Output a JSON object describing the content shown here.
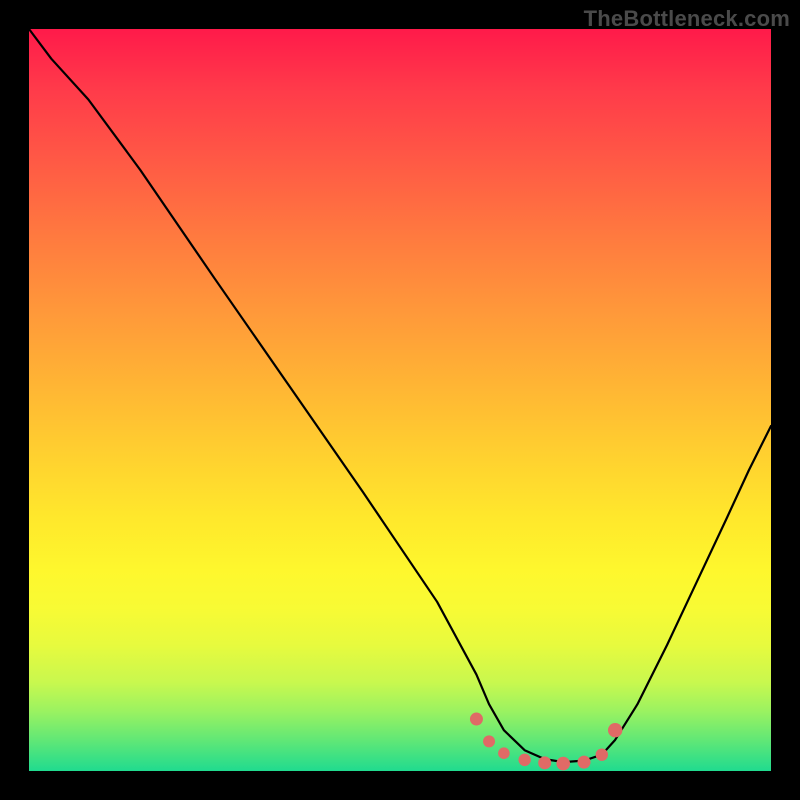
{
  "watermark": "TheBottleneck.com",
  "colors": {
    "frame_bg": "#000000",
    "gradient_top": "#ff1a4a",
    "gradient_bottom": "#20db8f",
    "curve_stroke": "#000000",
    "dot_fill": "#e06a66"
  },
  "chart_data": {
    "type": "line",
    "title": "",
    "xlabel": "",
    "ylabel": "",
    "xlim": [
      0,
      1
    ],
    "ylim": [
      0,
      1
    ],
    "x": [
      0.0,
      0.03,
      0.08,
      0.15,
      0.25,
      0.35,
      0.45,
      0.55,
      0.603,
      0.62,
      0.64,
      0.668,
      0.695,
      0.72,
      0.748,
      0.772,
      0.79,
      0.82,
      0.86,
      0.9,
      0.94,
      0.97,
      1.0
    ],
    "values": [
      1.0,
      0.96,
      0.905,
      0.81,
      0.664,
      0.52,
      0.376,
      0.228,
      0.13,
      0.09,
      0.055,
      0.028,
      0.016,
      0.012,
      0.014,
      0.022,
      0.042,
      0.09,
      0.17,
      0.255,
      0.34,
      0.405,
      0.465
    ],
    "series": [
      {
        "name": "curve",
        "x": [
          0.0,
          0.03,
          0.08,
          0.15,
          0.25,
          0.35,
          0.45,
          0.55,
          0.603,
          0.62,
          0.64,
          0.668,
          0.695,
          0.72,
          0.748,
          0.772,
          0.79,
          0.82,
          0.86,
          0.9,
          0.94,
          0.97,
          1.0
        ],
        "y": [
          1.0,
          0.96,
          0.905,
          0.81,
          0.664,
          0.52,
          0.376,
          0.228,
          0.13,
          0.09,
          0.055,
          0.028,
          0.016,
          0.012,
          0.014,
          0.022,
          0.042,
          0.09,
          0.17,
          0.255,
          0.34,
          0.405,
          0.465
        ]
      }
    ],
    "dots": {
      "x": [
        0.603,
        0.62,
        0.64,
        0.668,
        0.695,
        0.72,
        0.748,
        0.772,
        0.79
      ],
      "y": [
        0.07,
        0.04,
        0.024,
        0.015,
        0.011,
        0.01,
        0.012,
        0.022,
        0.055
      ],
      "r": [
        6.5,
        6.0,
        5.8,
        6.2,
        6.5,
        6.8,
        6.5,
        6.2,
        7.2
      ]
    }
  }
}
